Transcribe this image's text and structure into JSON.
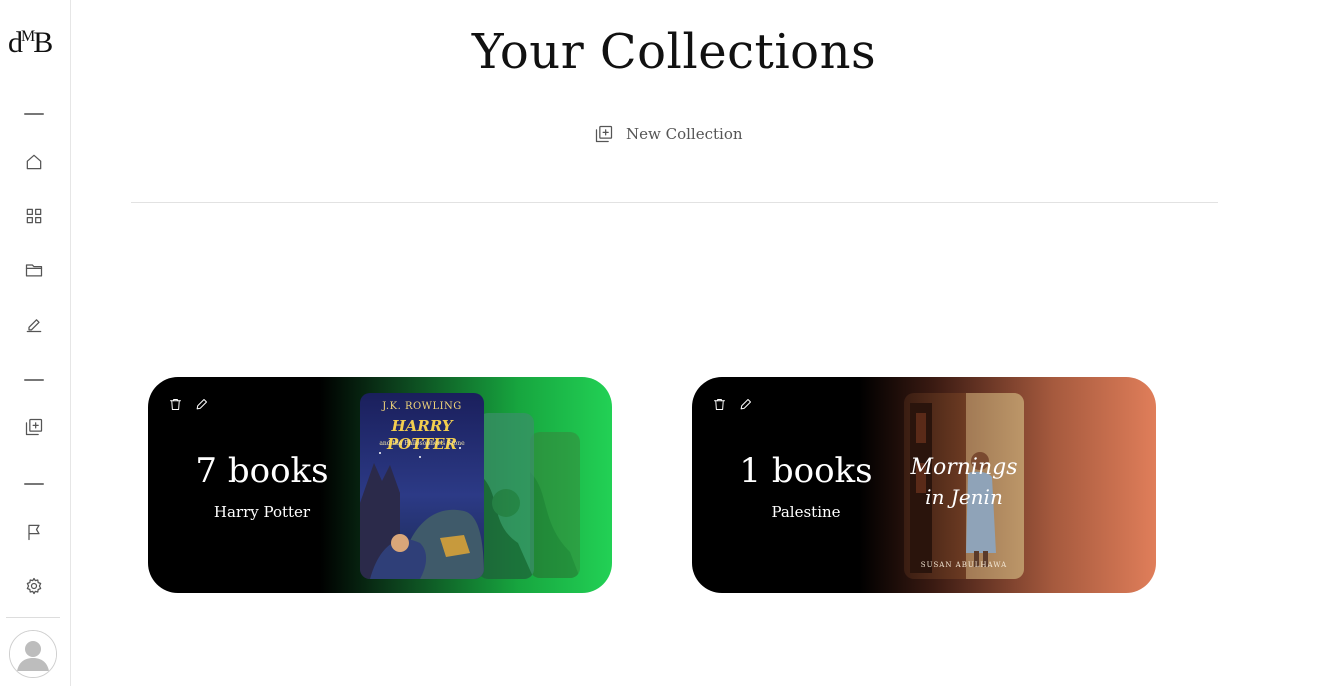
{
  "app": {
    "logo_text": "d",
    "logo_sup": "M",
    "logo_tail": "B"
  },
  "sidebar": {
    "items": [
      {
        "name": "home",
        "icon": "home-icon"
      },
      {
        "name": "grid",
        "icon": "grid-icon"
      },
      {
        "name": "folder",
        "icon": "folder-icon"
      },
      {
        "name": "edit",
        "icon": "edit-icon"
      },
      {
        "name": "add-collection",
        "icon": "add-square-icon"
      },
      {
        "name": "flag",
        "icon": "flag-icon"
      },
      {
        "name": "settings",
        "icon": "gear-icon"
      }
    ],
    "avatar_icon": "user-avatar-icon"
  },
  "main": {
    "title": "Your Collections",
    "new_collection_label": "New Collection"
  },
  "collections": [
    {
      "count_label": "7 books",
      "name": "Harry Potter",
      "accent": "#22d155",
      "cover": {
        "author": "J.K. ROWLING",
        "title": "HARRY POTTER",
        "subtitle": "and the Philosopher's Stone"
      }
    },
    {
      "count_label": "1 books",
      "name": "Palestine",
      "accent": "#e07e5a",
      "cover": {
        "title_line1": "Mornings",
        "title_line2": "in Jenin",
        "author": "SUSAN ABULHAWA"
      }
    }
  ],
  "colors": {
    "green_accent": "#22d155",
    "orange_accent": "#e07e5a",
    "card_base": "#000000"
  }
}
